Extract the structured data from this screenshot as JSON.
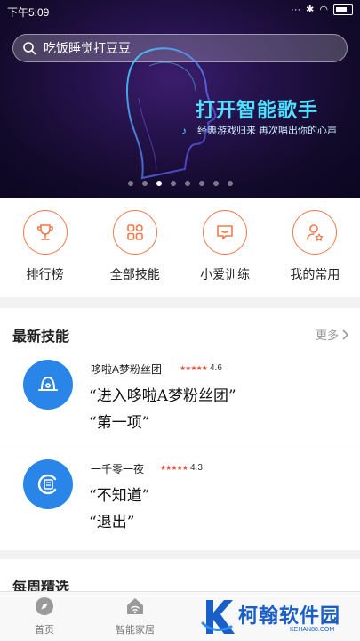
{
  "status_bar": {
    "time": "下午5:09"
  },
  "search": {
    "placeholder": "吃饭睡觉打豆豆"
  },
  "banner": {
    "title": "打开智能歌手",
    "subtitle": "经典游戏归来 再次唱出你的心声",
    "page_count": 8,
    "active_page": 3
  },
  "quick_actions": [
    {
      "label": "排行榜",
      "icon": "trophy-icon"
    },
    {
      "label": "全部技能",
      "icon": "grid-icon"
    },
    {
      "label": "小爱训练",
      "icon": "chat-bubble-icon"
    },
    {
      "label": "我的常用",
      "icon": "user-star-icon"
    }
  ],
  "latest_skills": {
    "title": "最新技能",
    "more_label": "更多",
    "items": [
      {
        "name": "哆啦A梦粉丝团",
        "stars": "★★★★★",
        "rating": "4.6",
        "phrase1": "“进入哆啦A梦粉丝团”",
        "phrase2": "“第一项”",
        "icon": "bell-icon"
      },
      {
        "name": "一千零一夜",
        "stars": "★★★★★",
        "rating": "4.3",
        "phrase1": "“不知道”",
        "phrase2": "“退出”",
        "icon": "book-icon"
      }
    ]
  },
  "weekly": {
    "title": "每周精选"
  },
  "bottom_nav": [
    {
      "label": "首页",
      "icon": "compass-icon"
    },
    {
      "label": "智能家居",
      "icon": "home-wifi-icon"
    }
  ],
  "watermark": {
    "text": "柯翰软件园",
    "sub": "KEHAN88.COM"
  },
  "colors": {
    "accent": "#f07a4b",
    "skill_blue": "#2a85e8",
    "banner_title": "#4fe0ff"
  }
}
